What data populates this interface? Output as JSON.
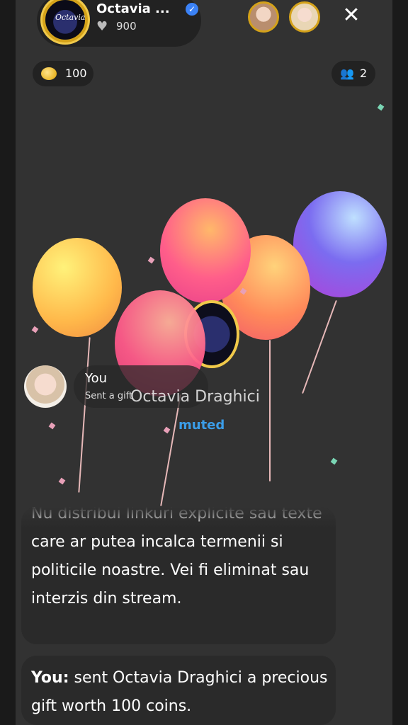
{
  "host": {
    "name": "Octavia ...",
    "likes": "900",
    "avatar_text": "Octavia",
    "overlay_name": "Octavia Draghici",
    "status": "muted"
  },
  "icons": {
    "verified": "verified-badge-icon",
    "heart": "heart-icon",
    "coins": "coins-icon",
    "users": "users-icon",
    "close": "close-icon"
  },
  "close_symbol": "✕",
  "coins": "100",
  "viewers_count": "2",
  "gift_event": {
    "user": "You",
    "text": "Sent a gift"
  },
  "rules_message": "Nu distribui linkuri explicite sau texte care ar putea incalca termenii si politicile noastre. Vei fi eliminat sau interzis din stream.",
  "chat": {
    "user": "You:",
    "message": "sent Octavia Draghici a precious gift worth 100 coins."
  },
  "colors": {
    "accent_blue": "#3b9de8",
    "gold": "#d4a21a",
    "background": "#323232"
  }
}
